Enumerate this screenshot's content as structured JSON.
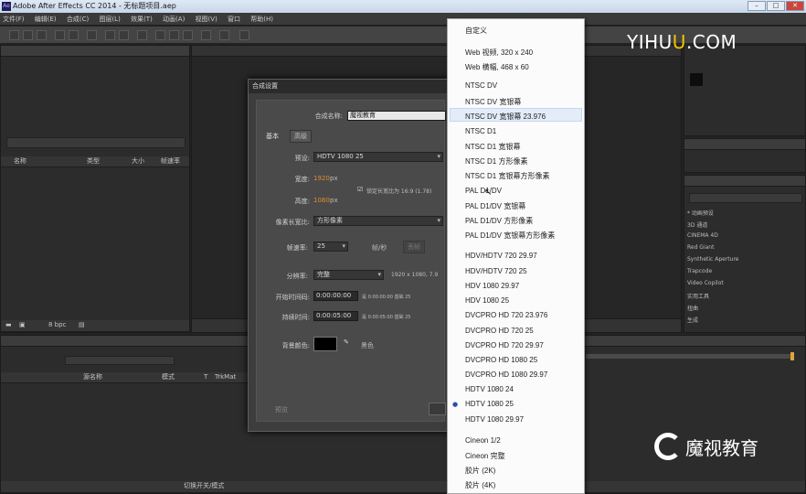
{
  "titlebar": {
    "title": "Adobe After Effects CC 2014 - 无标题项目.aep",
    "app_icon": "Ae",
    "minimize": "–",
    "maximize": "□",
    "close": "✕"
  },
  "menu": [
    "文件(F)",
    "编辑(E)",
    "合成(C)",
    "图层(L)",
    "效果(T)",
    "动画(A)",
    "视图(V)",
    "窗口",
    "帮助(H)"
  ],
  "project_panel": {
    "columns": [
      "名称",
      "类型",
      "大小",
      "帧速率"
    ],
    "footer_bpc": "8 bpc"
  },
  "timeline": {
    "columns": [
      "源名称",
      "模式",
      "T",
      "TrkMat"
    ],
    "footer": "切换开关/模式"
  },
  "dialog": {
    "title": "合成设置",
    "name_label": "合成名称:",
    "name_value": "魔视教育",
    "tab_basic": "基本",
    "tab_advanced": "高级",
    "preset_label": "预设:",
    "preset_value": "HDTV 1080 25",
    "width_label": "宽度:",
    "width_value": "1920",
    "height_label": "高度:",
    "height_value": "1080",
    "px": "px",
    "lock_label": "锁定长宽比为 16:9 (1.78)",
    "par_label": "像素长宽比:",
    "par_value": "方形像素",
    "fps_label": "帧速率:",
    "fps_value": "25",
    "fps_unit": "帧/秒",
    "drop_frame": "丢帧",
    "res_label": "分辨率:",
    "res_value": "完整",
    "res_info": "1920 x 1080, 7.9",
    "start_label": "开始时间码:",
    "start_value": "0:00:00:00",
    "start_info": "是 0:00:00:00 基础 25",
    "dur_label": "持续时间:",
    "dur_value": "0:00:05:00",
    "dur_info": "是 0:00:05:00 基础 25",
    "bg_label": "背景颜色:",
    "bg_color_name": "黑色",
    "bg_color": "#000000",
    "preview_label": "预览"
  },
  "preset_list": {
    "selected": "HDTV 1080 25",
    "highlighted": "NTSC DV 宽银幕 23.976",
    "items": [
      "自定义",
      "",
      "Web 视频, 320 x 240",
      "Web 横幅, 468 x 60",
      "",
      "NTSC DV",
      "NTSC DV 宽银幕",
      "NTSC DV 宽银幕 23.976",
      "NTSC D1",
      "NTSC D1 宽银幕",
      "NTSC D1 方形像素",
      "NTSC D1 宽银幕方形像素",
      "PAL D1/DV",
      "PAL D1/DV 宽银幕",
      "PAL D1/DV 方形像素",
      "PAL D1/DV 宽银幕方形像素",
      "",
      "HDV/HDTV 720 29.97",
      "HDV/HDTV 720 25",
      "HDV 1080 29.97",
      "HDV 1080 25",
      "DVCPRO HD 720 23.976",
      "DVCPRO HD 720 25",
      "DVCPRO HD 720 29.97",
      "DVCPRO HD 1080 25",
      "DVCPRO HD 1080 29.97",
      "HDTV 1080 24",
      "HDTV 1080 25",
      "HDTV 1080 29.97",
      "",
      "Cineon 1/2",
      "Cineon 完整",
      "胶片 (2K)",
      "胶片 (4K)"
    ]
  },
  "effects": [
    "* 动画预设",
    "3D 通道",
    "CINEMA 4D",
    "Red Giant",
    "Synthetic Aperture",
    "Trapcode",
    "Video Copilot",
    "实用工具",
    "扭曲",
    "生成"
  ],
  "watermark_top": {
    "pre": "YIHU",
    "u": "U",
    "post": ".COM"
  },
  "watermark_bottom": "魔视教育"
}
